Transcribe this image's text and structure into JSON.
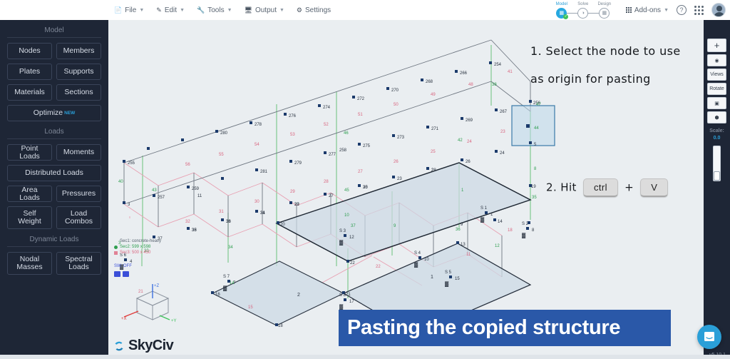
{
  "topbar": {
    "menu": [
      {
        "label": "File",
        "icon": "file-icon",
        "caret": true
      },
      {
        "label": "Edit",
        "icon": "pencil-icon",
        "caret": true
      },
      {
        "label": "Tools",
        "icon": "wrench-icon",
        "caret": true
      },
      {
        "label": "Output",
        "icon": "monitor-icon",
        "caret": true
      },
      {
        "label": "Settings",
        "icon": "gear-icon",
        "caret": false
      }
    ],
    "workflow": [
      {
        "label": "Model",
        "state": "active",
        "glyph": "▤"
      },
      {
        "label": "Solve",
        "state": "idle",
        "glyph": "◔"
      },
      {
        "label": "Design",
        "state": "idle",
        "glyph": "▤"
      }
    ],
    "addons_label": "Add-ons",
    "help_glyph": "?",
    "apps_icon": "apps-grid-icon",
    "avatar": "user-avatar"
  },
  "sidebar": {
    "sections": [
      {
        "title": "Model",
        "buttons": [
          {
            "label": "Nodes",
            "width": "half"
          },
          {
            "label": "Members",
            "width": "half"
          },
          {
            "label": "Plates",
            "width": "half"
          },
          {
            "label": "Supports",
            "width": "half"
          },
          {
            "label": "Materials",
            "width": "half"
          },
          {
            "label": "Sections",
            "width": "half"
          },
          {
            "label": "Optimize",
            "width": "full",
            "badge": "NEW"
          }
        ]
      },
      {
        "title": "Loads",
        "buttons": [
          {
            "label": "Point Loads",
            "width": "half"
          },
          {
            "label": "Moments",
            "width": "half"
          },
          {
            "label": "Distributed Loads",
            "width": "full"
          },
          {
            "label": "Area Loads",
            "width": "half"
          },
          {
            "label": "Pressures",
            "width": "half"
          },
          {
            "label": "Self Weight",
            "width": "half",
            "tall": true
          },
          {
            "label": "Load Combos",
            "width": "half",
            "tall": true
          }
        ]
      },
      {
        "title": "Dynamic Loads",
        "buttons": [
          {
            "label": "Nodal Masses",
            "width": "half",
            "tall": true
          },
          {
            "label": "Spectral Loads",
            "width": "half",
            "tall": true
          }
        ]
      }
    ]
  },
  "toolpanel": {
    "buttons": [
      {
        "name": "zoom-in-button",
        "glyph": "+"
      },
      {
        "name": "visibility-eye-button",
        "glyph": "◉"
      },
      {
        "name": "views-button",
        "glyph": "Views"
      },
      {
        "name": "rotate-button",
        "glyph": "Rotate"
      },
      {
        "name": "camera-button",
        "glyph": "▣"
      },
      {
        "name": "render-3d-button",
        "glyph": "⬢"
      }
    ],
    "scale_label": "Scale:",
    "scale_value": "0.0"
  },
  "legend": {
    "rows": [
      {
        "label": "Sec1: concrete-heavy",
        "color": "#55606d",
        "swatch": "none"
      },
      {
        "label": "Sec2: 599 x 598",
        "color": "#2e9e4f",
        "swatch": "green"
      },
      {
        "label": "Sec3: 500 x 450",
        "color": "#d9657f",
        "swatch": "pink"
      }
    ],
    "self_weight": "SW: OFF",
    "icons": [
      "unlock-icon",
      "table-icon"
    ]
  },
  "axis_cube": {
    "x_label": "+X",
    "y_label": "+Y",
    "z_label": "+Z",
    "x_color": "#e03b3b",
    "y_color": "#3fc35b",
    "z_color": "#3b6fe0"
  },
  "annotations": {
    "step1_line1": "1. Select the node to use",
    "step1_line2": "as origin for pasting",
    "step2_prefix": "2. Hit",
    "key_ctrl": "ctrl",
    "key_plus": "+",
    "key_v": "V"
  },
  "caption": {
    "text": "Pasting the copied structure",
    "bg": "#2a58a8"
  },
  "footer": {
    "logo_text": "SkyCiv",
    "version": "v5.10.1",
    "intercom": "chat-bubble-icon"
  },
  "model": {
    "node_color": "#1b3a6b",
    "member_color": "#6e7681",
    "brace_color": "#e8a0b2",
    "column_color": "#7fc98f",
    "plate_fill": "#ccd9e4",
    "selection_fill": "#bcd8ea",
    "selection_stroke": "#3a7aa8",
    "top_nodes": [
      254,
      266,
      268,
      270,
      272,
      274,
      276,
      278,
      280,
      255,
      256,
      257,
      259,
      258,
      267,
      269,
      271,
      273,
      275,
      277,
      279,
      281
    ],
    "mid_nodes": [
      2,
      23,
      25,
      27,
      29,
      31,
      33,
      35,
      37,
      11,
      24,
      26,
      28,
      30,
      32,
      34,
      36,
      38,
      3,
      5,
      6,
      9
    ],
    "lower_nodes": [
      13,
      14,
      16,
      18,
      19,
      20,
      21,
      22
    ],
    "member_labels_green": [
      40,
      43,
      44,
      45,
      46,
      48,
      38,
      8,
      6,
      7,
      9,
      12,
      14,
      33,
      34,
      35,
      36,
      37,
      3,
      1
    ],
    "member_labels_pink": [
      41,
      47,
      49,
      50,
      51,
      52,
      53,
      54,
      55,
      56,
      21,
      22,
      23,
      24,
      25,
      26,
      27,
      28,
      29,
      30,
      31,
      32,
      11,
      15,
      18
    ],
    "plate_labels": [
      1,
      2
    ],
    "supports": [
      {
        "tag": "S 1",
        "node": "1"
      },
      {
        "tag": "S 2",
        "node": "8"
      },
      {
        "tag": "S 3",
        "node": "12"
      },
      {
        "tag": "S 4",
        "node": "10"
      },
      {
        "tag": "S 5",
        "node": "15"
      },
      {
        "tag": "S 6",
        "node": "4"
      },
      {
        "tag": "S 7",
        "node": "7"
      },
      {
        "tag": "S 8",
        "node": "17"
      }
    ],
    "selected_node": "5"
  }
}
